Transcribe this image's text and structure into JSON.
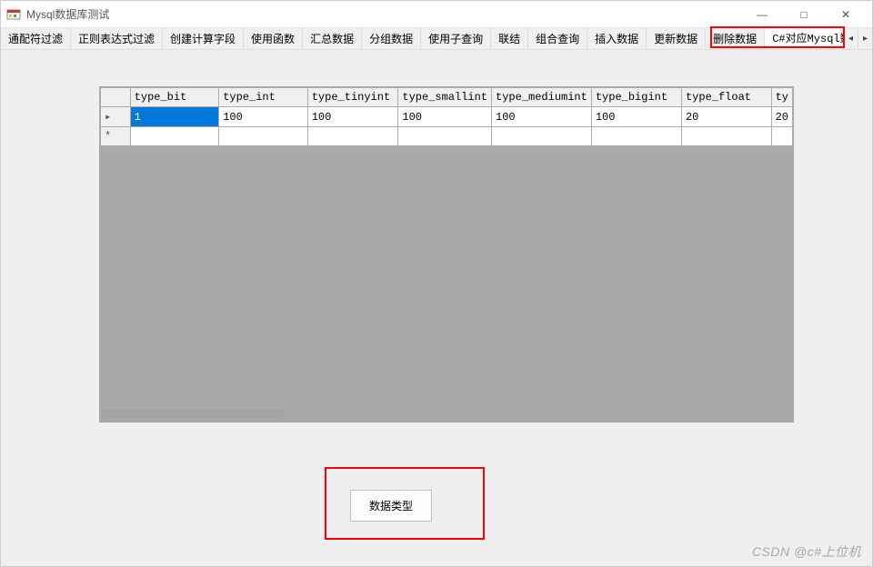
{
  "window": {
    "title": "Mysql数据库测试"
  },
  "tabs": [
    {
      "label": "通配符过滤"
    },
    {
      "label": "正则表达式过滤"
    },
    {
      "label": "创建计算字段"
    },
    {
      "label": "使用函数"
    },
    {
      "label": "汇总数据"
    },
    {
      "label": "分组数据"
    },
    {
      "label": "使用子查询"
    },
    {
      "label": "联结"
    },
    {
      "label": "组合查询"
    },
    {
      "label": "插入数据"
    },
    {
      "label": "更新数据"
    },
    {
      "label": "删除数据"
    },
    {
      "label": "C#对应Mysql数据类型"
    }
  ],
  "active_tab_index": 12,
  "tabnav": {
    "left": "◂",
    "right": "▸"
  },
  "datagrid": {
    "columns": [
      "type_bit",
      "type_int",
      "type_tinyint",
      "type_smallint",
      "type_mediumint",
      "type_bigint",
      "type_float"
    ],
    "last_col_fragment": "ty",
    "rows": [
      {
        "marker": "▸",
        "cells": [
          "1",
          "100",
          "100",
          "100",
          "100",
          "100",
          "20"
        ],
        "last": "20",
        "selected_col": 0
      },
      {
        "marker": "*",
        "cells": [
          "",
          "",
          "",
          "",
          "",
          "",
          ""
        ],
        "last": ""
      }
    ]
  },
  "button": {
    "label": "数据类型"
  },
  "watermark": "CSDN @c#上位机",
  "wincontrols": {
    "min": "—",
    "max": "□",
    "close": "✕"
  }
}
